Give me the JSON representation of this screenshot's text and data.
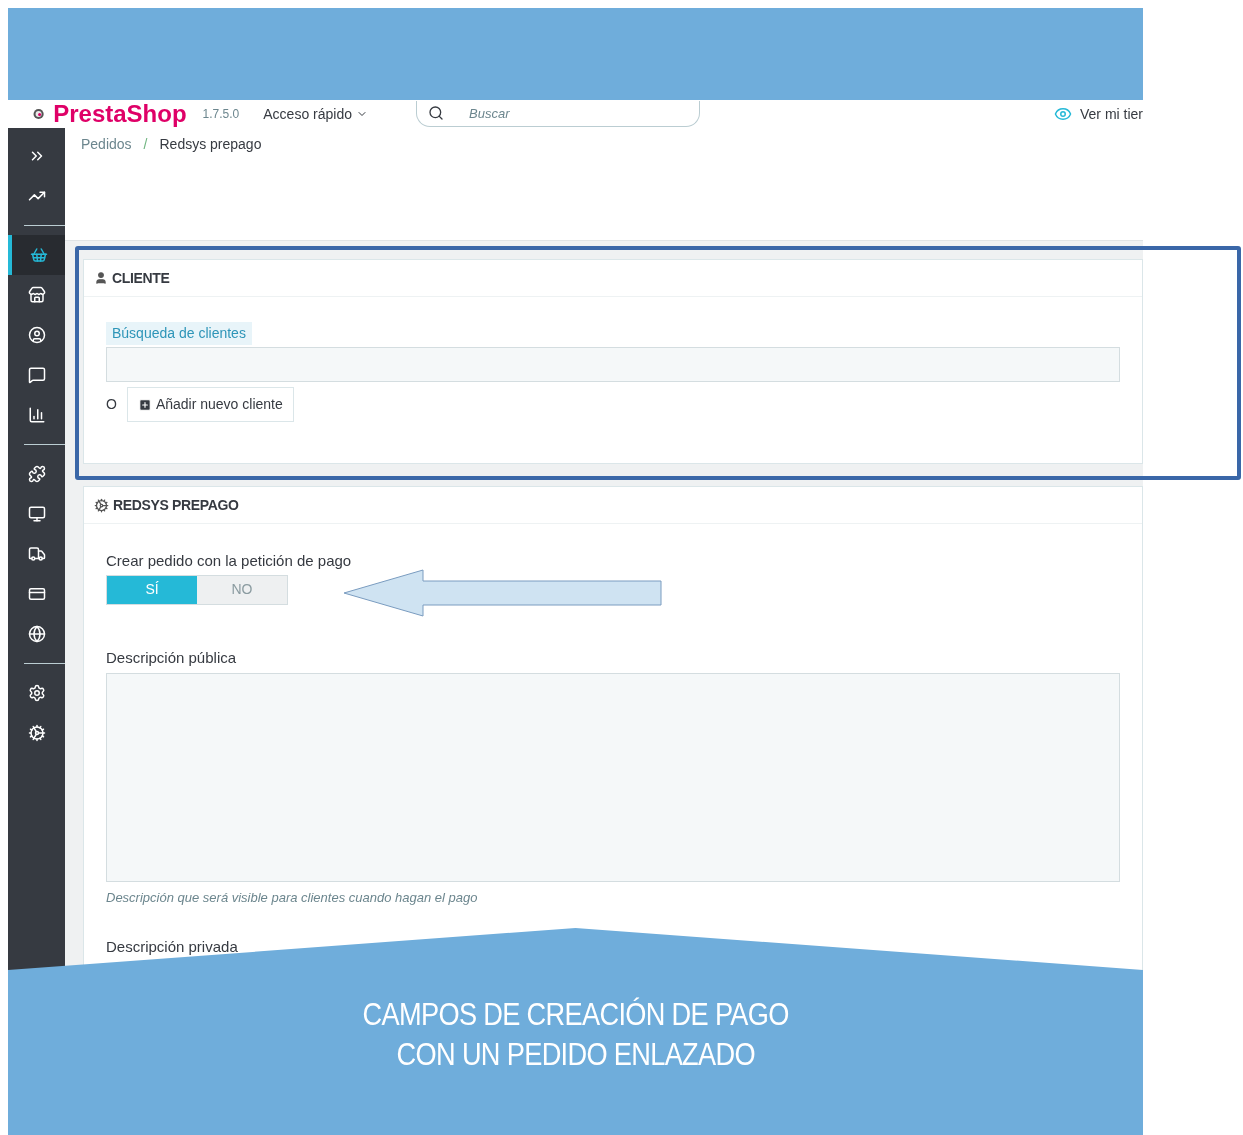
{
  "header": {
    "logo": "PrestaShop",
    "version": "1.7.5.0",
    "quick_access": "Acceso rápido",
    "search": {
      "placeholder": "Buscar"
    },
    "view_store": "Ver mi tier"
  },
  "sidebar": {
    "items": [
      {
        "kind": "expand",
        "selected": false
      },
      {
        "kind": "stats",
        "selected": false
      },
      {
        "kind": "divider"
      },
      {
        "kind": "orders",
        "selected": true
      },
      {
        "kind": "catalog",
        "selected": false
      },
      {
        "kind": "customers",
        "selected": false
      },
      {
        "kind": "messages",
        "selected": false
      },
      {
        "kind": "reports",
        "selected": false
      },
      {
        "kind": "divider"
      },
      {
        "kind": "modules",
        "selected": false
      },
      {
        "kind": "design",
        "selected": false
      },
      {
        "kind": "shipping",
        "selected": false
      },
      {
        "kind": "payment",
        "selected": false
      },
      {
        "kind": "international",
        "selected": false
      },
      {
        "kind": "divider"
      },
      {
        "kind": "settings",
        "selected": false
      },
      {
        "kind": "advanced",
        "selected": false
      }
    ]
  },
  "breadcrumb": {
    "items": [
      "Pedidos",
      "Redsys prepago"
    ],
    "separator": "/"
  },
  "customer_panel": {
    "title": "CLIENTE",
    "search_label": "Búsqueda de clientes",
    "or": "O",
    "add_button": "Añadir nuevo cliente"
  },
  "redsys_panel": {
    "title": "REDSYS PREPAGO",
    "create_order": {
      "label": "Crear pedido con la petición de pago",
      "options": [
        {
          "label": "SÍ",
          "selected": true
        },
        {
          "label": "NO",
          "selected": false
        }
      ]
    },
    "public_description": {
      "label": "Descripción pública",
      "help": "Descripción que será visible para clientes cuando hagan el pago"
    },
    "private_description": {
      "label": "Descripción privada"
    }
  },
  "banner": {
    "lines": [
      "CAMPOS DE CREACIÓN DE PAGO",
      "CON UN PEDIDO ENLAZADO"
    ]
  }
}
